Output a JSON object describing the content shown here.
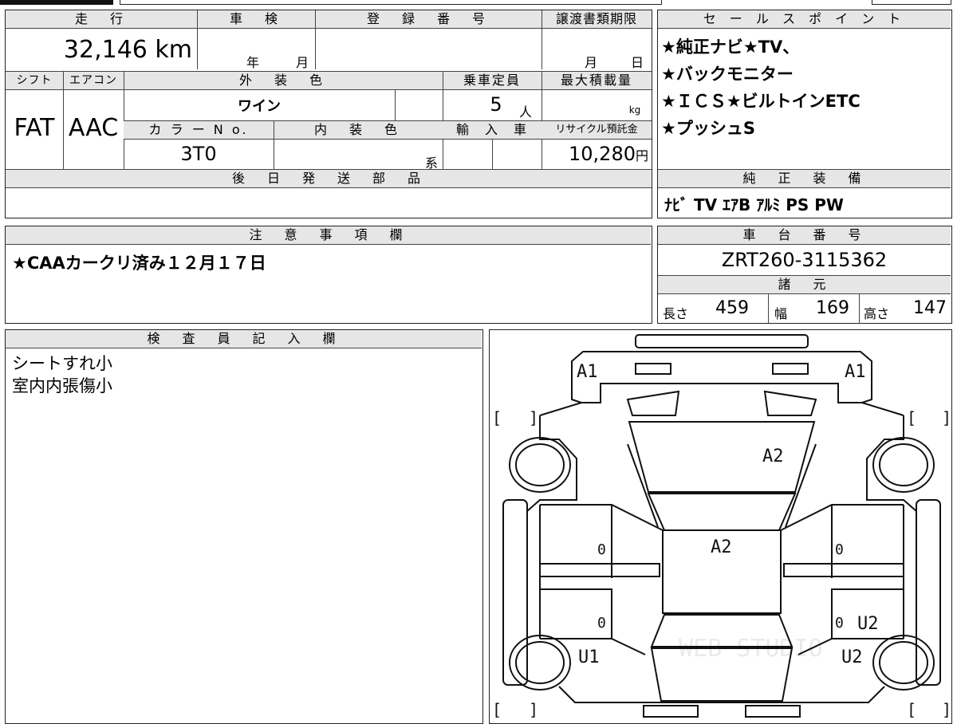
{
  "summary": {
    "labels": {
      "mileage": "走　行",
      "inspection": "車　検",
      "registration": "登　録　番　号",
      "transfer_deadline": "譲渡書類期限",
      "shift": "シフト",
      "aircon": "エアコン",
      "exterior_color": "外　装　色",
      "capacity": "乗車定員",
      "max_load": "最大積載量",
      "color_no": "カ ラ ー N o.",
      "interior_color": "内　装　色",
      "imported": "輸　入　車",
      "recycle_fee": "リサイクル預託金",
      "delivery_parts": "後　日　発　送　部　品"
    },
    "values": {
      "mileage": "32,146 km",
      "inspection_year": "年",
      "inspection_month": "月",
      "transfer_month": "月",
      "transfer_day": "日",
      "shift": "FAT",
      "aircon": "AAC",
      "exterior_color": "ワイン",
      "capacity_num": "5",
      "capacity_unit": "人",
      "load_unit": "kg",
      "color_no": "3T0",
      "interior_suffix": "系",
      "recycle_fee": "10,280",
      "recycle_unit": "円"
    }
  },
  "sales_points": {
    "title": "セ ー ル ス ポ イ ン ト",
    "lines": [
      "★純正ナビ★TV、",
      "★バックモニター",
      "★ＩＣＳ★ビルトインETC",
      "★プッシュS"
    ]
  },
  "genuine_equipment": {
    "title": "純　正　装　備",
    "items": "ﾅﾋﾞ TV ｴｱB ｱﾙﾐ PS PW"
  },
  "caution": {
    "title": "注　意　事　項　欄",
    "text": "★CAAカークリ済み１２月１７日"
  },
  "chassis": {
    "title": "車　台　番　号",
    "number": "ZRT260-3115362"
  },
  "specs": {
    "title": "諸　元",
    "length_label": "長さ",
    "length": "459",
    "width_label": "幅",
    "width": "169",
    "height_label": "高さ",
    "height": "147"
  },
  "inspector": {
    "title": "検　査　員　記　入　欄",
    "lines": [
      "シートすれ小",
      "室内内張傷小"
    ]
  },
  "diagram": {
    "marks": {
      "front_left": "A1",
      "front_right": "A1",
      "hood": "A2",
      "roof": "A2",
      "door_fl": "0",
      "door_fr": "0",
      "door_rl": "0",
      "door_rr": "0",
      "rear_right_door": "U2",
      "rear_left_fender": "U1",
      "rear_right_fender": "U2",
      "bracket_open": "[",
      "bracket_close": "]"
    },
    "watermark": "WEB STUDIO"
  }
}
